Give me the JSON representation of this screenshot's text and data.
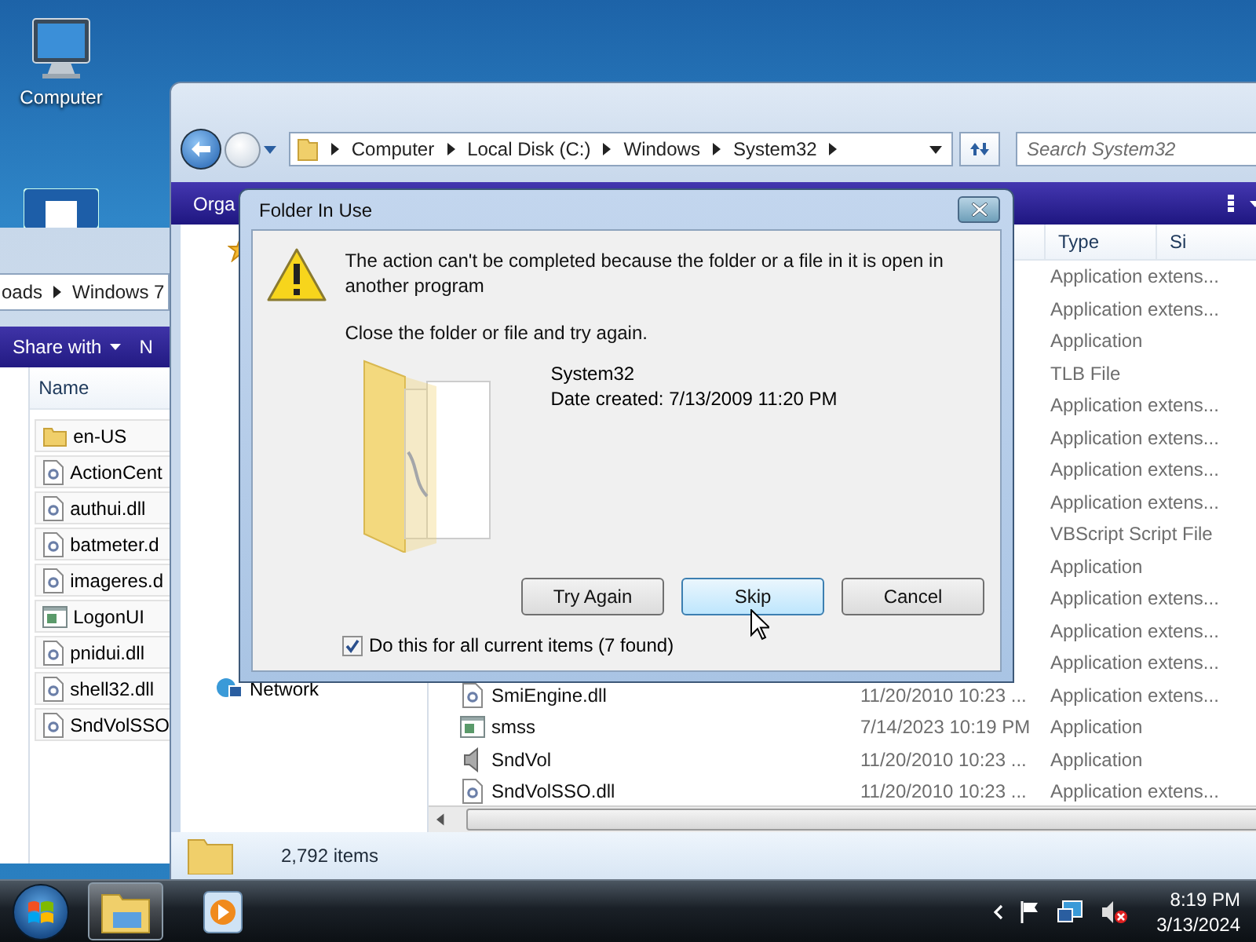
{
  "desktop": {
    "icons": [
      {
        "label": "Computer"
      }
    ]
  },
  "back_window": {
    "breadcrumb": [
      "oads",
      "Windows 7"
    ],
    "toolbar": [
      "Share with",
      "N"
    ],
    "columns": [
      "Name"
    ],
    "files": [
      {
        "name": "en-US",
        "kind": "folder"
      },
      {
        "name": "ActionCent",
        "kind": "dll"
      },
      {
        "name": "authui.dll",
        "kind": "dll"
      },
      {
        "name": "batmeter.d",
        "kind": "dll"
      },
      {
        "name": "imageres.d",
        "kind": "dll"
      },
      {
        "name": "LogonUI",
        "kind": "app"
      },
      {
        "name": "pnidui.dll",
        "kind": "dll"
      },
      {
        "name": "shell32.dll",
        "kind": "dll"
      },
      {
        "name": "SndVolSSO",
        "kind": "dll"
      }
    ]
  },
  "explorer": {
    "address": [
      "Computer",
      "Local Disk (C:)",
      "Windows",
      "System32"
    ],
    "search": {
      "placeholder": "Search System32"
    },
    "toolbar": [
      "Orga"
    ],
    "nav_pane": {
      "items": [
        "Network"
      ]
    },
    "columns": [
      "Type",
      "Si"
    ],
    "rows": [
      {
        "type": "Application extens..."
      },
      {
        "type": "Application extens..."
      },
      {
        "type": "Application"
      },
      {
        "type": "TLB File"
      },
      {
        "type": "Application extens..."
      },
      {
        "type": "Application extens..."
      },
      {
        "type": "Application extens..."
      },
      {
        "type": "Application extens..."
      },
      {
        "type": "VBScript Script File"
      },
      {
        "type": "Application"
      },
      {
        "type": "Application extens..."
      },
      {
        "type": "Application extens..."
      },
      {
        "type": "Application extens..."
      },
      {
        "name": "SmiEngine.dll",
        "date": "11/20/2010 10:23 ...",
        "type": "Application extens...",
        "kind": "dll"
      },
      {
        "name": "smss",
        "date": "7/14/2023 10:19 PM",
        "type": "Application",
        "kind": "app"
      },
      {
        "name": "SndVol",
        "date": "11/20/2010 10:23 ...",
        "type": "Application",
        "kind": "speaker"
      },
      {
        "name": "SndVolSSO.dll",
        "date": "11/20/2010 10:23 ...",
        "type": "Application extens...",
        "kind": "dll"
      }
    ],
    "status_bar": "2,792 items"
  },
  "dialog": {
    "title": "Folder In Use",
    "message": "The action can't be completed because the folder or a file in it is open in another program",
    "instruction": "Close the folder or file and try again.",
    "item": {
      "name": "System32",
      "date_created": "Date created: 7/13/2009 11:20 PM"
    },
    "buttons": [
      {
        "label": "Try Again",
        "selected": false
      },
      {
        "label": "Skip",
        "selected": true
      },
      {
        "label": "Cancel",
        "selected": false
      }
    ],
    "checkbox": {
      "label": "Do this for all current items (7 found)",
      "checked": true
    }
  },
  "taskbar": {
    "apps": [
      {
        "kind": "explorer",
        "active": true
      },
      {
        "kind": "media_player",
        "active": false
      }
    ],
    "clock": {
      "time": "8:19 PM",
      "date": "3/13/2024"
    }
  }
}
